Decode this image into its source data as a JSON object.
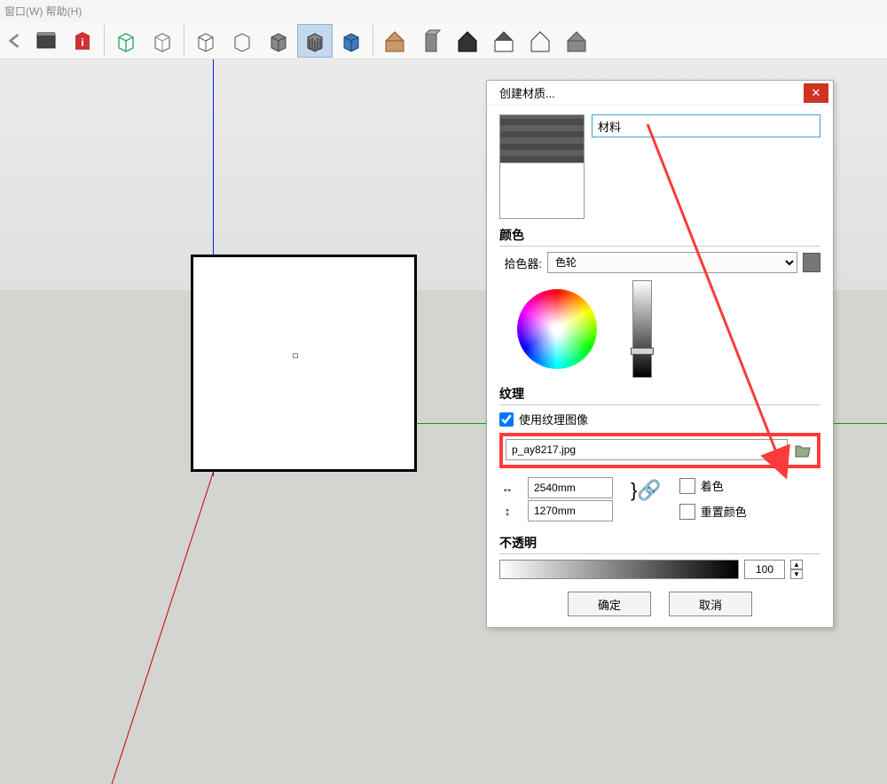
{
  "menu": {
    "visible_text": "窗口(W)  帮助(H)"
  },
  "toolbar": {
    "icons": [
      "undo",
      "file",
      "info",
      "cube-wire",
      "cube-open",
      "box",
      "box-outline",
      "box-shadow",
      "box-stripe",
      "box-blue",
      "house-color",
      "building",
      "house-bw",
      "house-roof",
      "house-line",
      "house-flat"
    ]
  },
  "dialog": {
    "title": "创建材质...",
    "close": "✕",
    "name_value": "材料",
    "color_section": "颜色",
    "picker_label": "拾色器:",
    "picker_value": "色轮",
    "texture_section": "纹理",
    "use_texture_label": "使用纹理图像",
    "use_texture_checked": true,
    "texture_file": "p_ay8217.jpg",
    "width_value": "2540mm",
    "height_value": "1270mm",
    "colorize_label": "着色",
    "reset_color_label": "重置颜色",
    "opacity_section": "不透明",
    "opacity_value": "100",
    "ok": "确定",
    "cancel": "取消"
  }
}
